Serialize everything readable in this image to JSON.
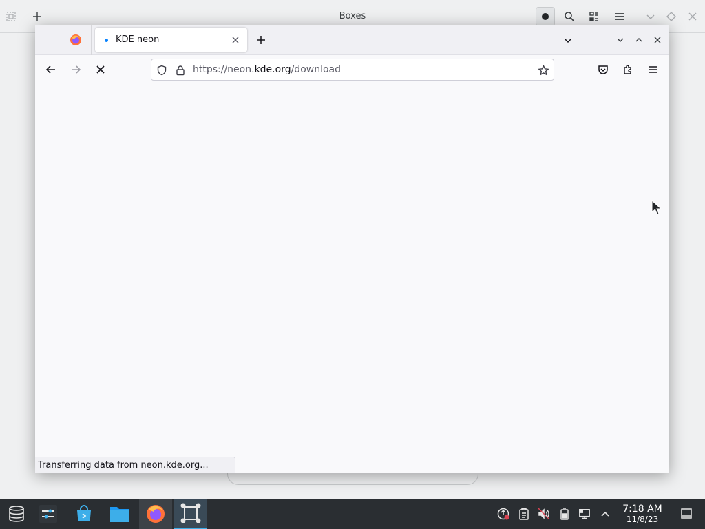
{
  "boxes": {
    "title": "Boxes"
  },
  "firefox": {
    "tabs": [
      {
        "title": "KDE neon",
        "active": true
      }
    ],
    "url": {
      "scheme_prefix": "https://neon.",
      "host": "kde.org",
      "path": "/download"
    },
    "status": "Transferring data from neon.kde.org..."
  },
  "taskbar": {
    "clock": {
      "time": "7:18 AM",
      "date": "11/8/23"
    }
  },
  "colors": {
    "accent": "#3daee9",
    "firefox_tab_loading_dot": "#0a84ff",
    "taskbar_bg": "#2a2e32"
  },
  "icons": {
    "boxes_header": [
      "sidebar-toggle-icon",
      "new-box-icon",
      "record-icon",
      "search-icon",
      "select-icon",
      "menu-icon",
      "minimize-icon",
      "maximize-icon",
      "close-icon"
    ],
    "firefox_nav": [
      "back-icon",
      "forward-icon",
      "stop-icon",
      "shield-icon",
      "lock-icon",
      "star-icon",
      "pocket-icon",
      "extensions-icon",
      "hamburger-menu-icon"
    ],
    "taskbar": [
      "app-launcher-icon",
      "system-settings-icon",
      "discover-icon",
      "dolphin-icon",
      "firefox-icon",
      "boxes-icon"
    ],
    "tray": [
      "update-icon",
      "clipboard-icon",
      "volume-muted-icon",
      "battery-icon",
      "network-icon",
      "tray-expand-icon",
      "show-desktop-icon"
    ]
  }
}
